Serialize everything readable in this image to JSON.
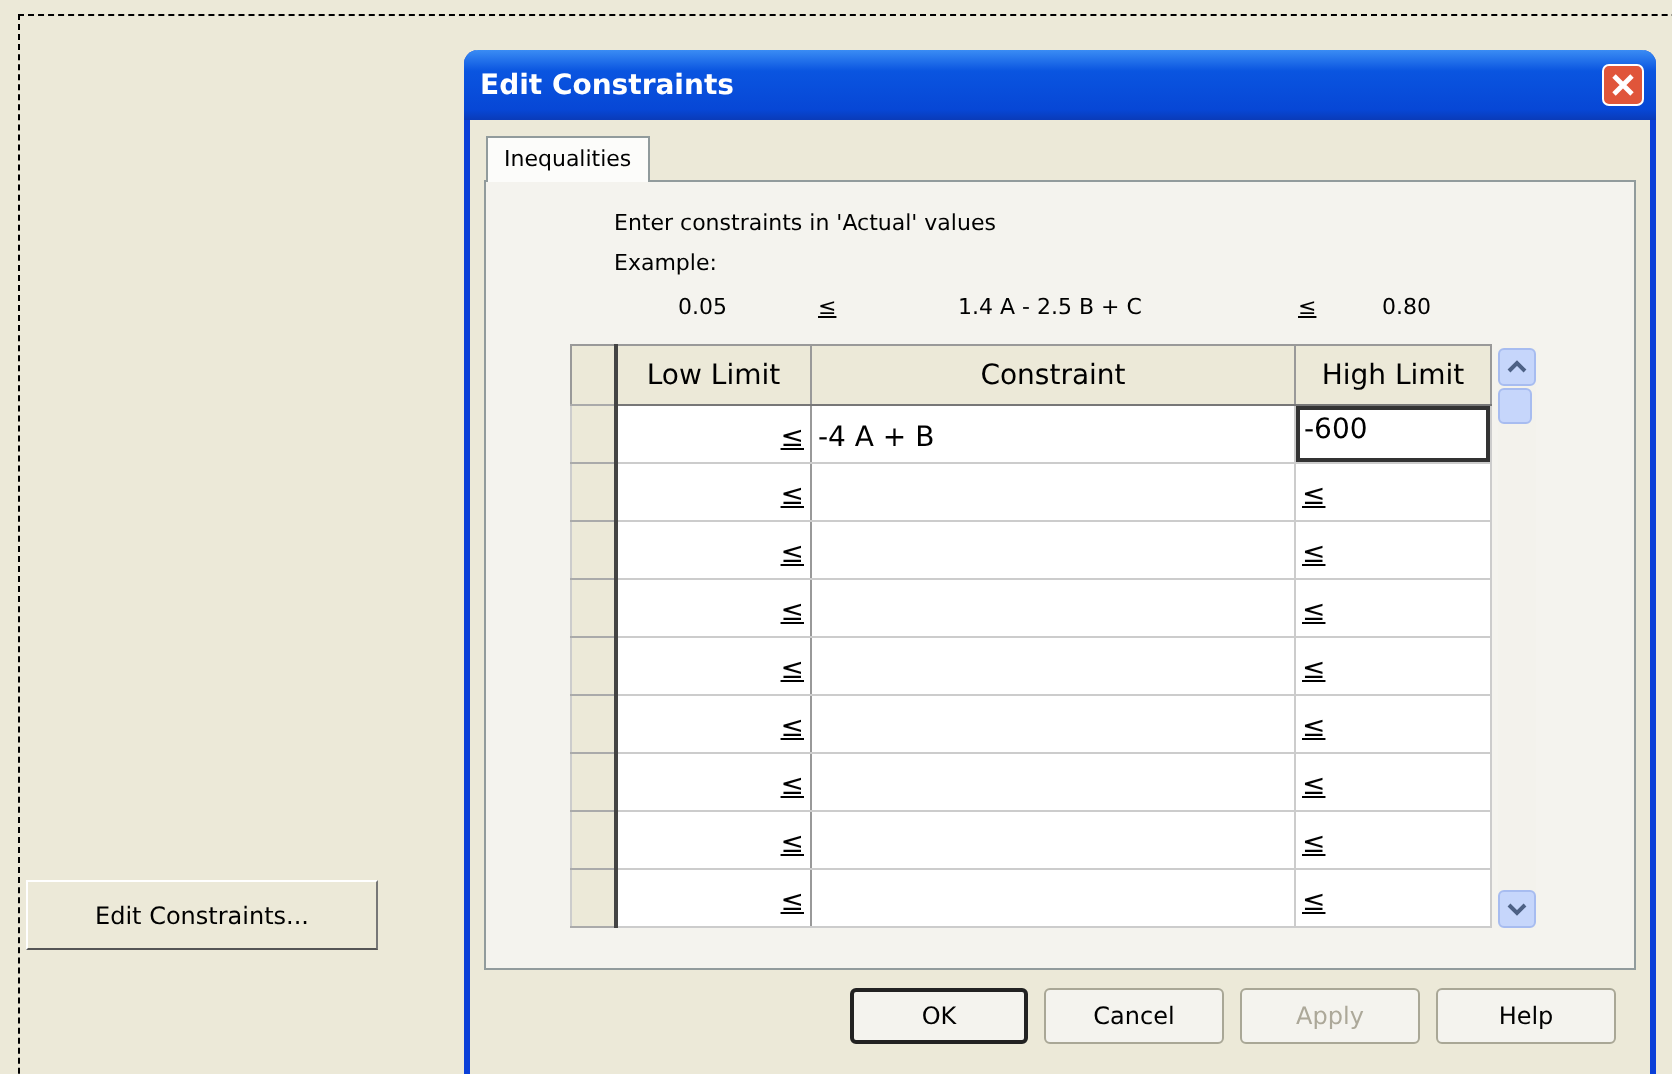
{
  "background": {
    "button": "Edit Constraints..."
  },
  "window": {
    "title": "Edit Constraints"
  },
  "tabs": [
    {
      "label": "Inequalities",
      "selected": true
    }
  ],
  "instructions": "Enter constraints in 'Actual' values",
  "example_label": "Example:",
  "example": {
    "low": "0.05",
    "op_low": "≤",
    "expression": "1.4 A - 2.5 B + C",
    "op_high": "≤",
    "high": "0.80"
  },
  "table": {
    "columns": [
      "Low Limit",
      "Constraint",
      "High Limit"
    ],
    "rows": [
      {
        "low_limit": "≤",
        "constraint": "-4 A  + B",
        "high_limit": "-600",
        "editing": true
      },
      {
        "low_limit": "≤",
        "high_limit": "≤",
        "editing": false
      },
      {
        "low_limit": "≤",
        "high_limit": "≤",
        "editing": false
      },
      {
        "low_limit": "≤",
        "high_limit": "≤",
        "editing": false
      },
      {
        "low_limit": "≤",
        "high_limit": "≤",
        "editing": false
      },
      {
        "low_limit": "≤",
        "high_limit": "≤",
        "editing": false
      },
      {
        "low_limit": "≤",
        "high_limit": "≤",
        "editing": false
      },
      {
        "low_limit": "≤",
        "high_limit": "≤",
        "editing": false
      },
      {
        "low_limit": "≤",
        "high_limit": "≤",
        "editing": false
      }
    ]
  },
  "buttons": [
    {
      "label": "OK",
      "default": true,
      "disabled": false
    },
    {
      "label": "Cancel",
      "default": false,
      "disabled": false
    },
    {
      "label": "Apply",
      "default": false,
      "disabled": true
    },
    {
      "label": "Help",
      "default": false,
      "disabled": false
    }
  ]
}
